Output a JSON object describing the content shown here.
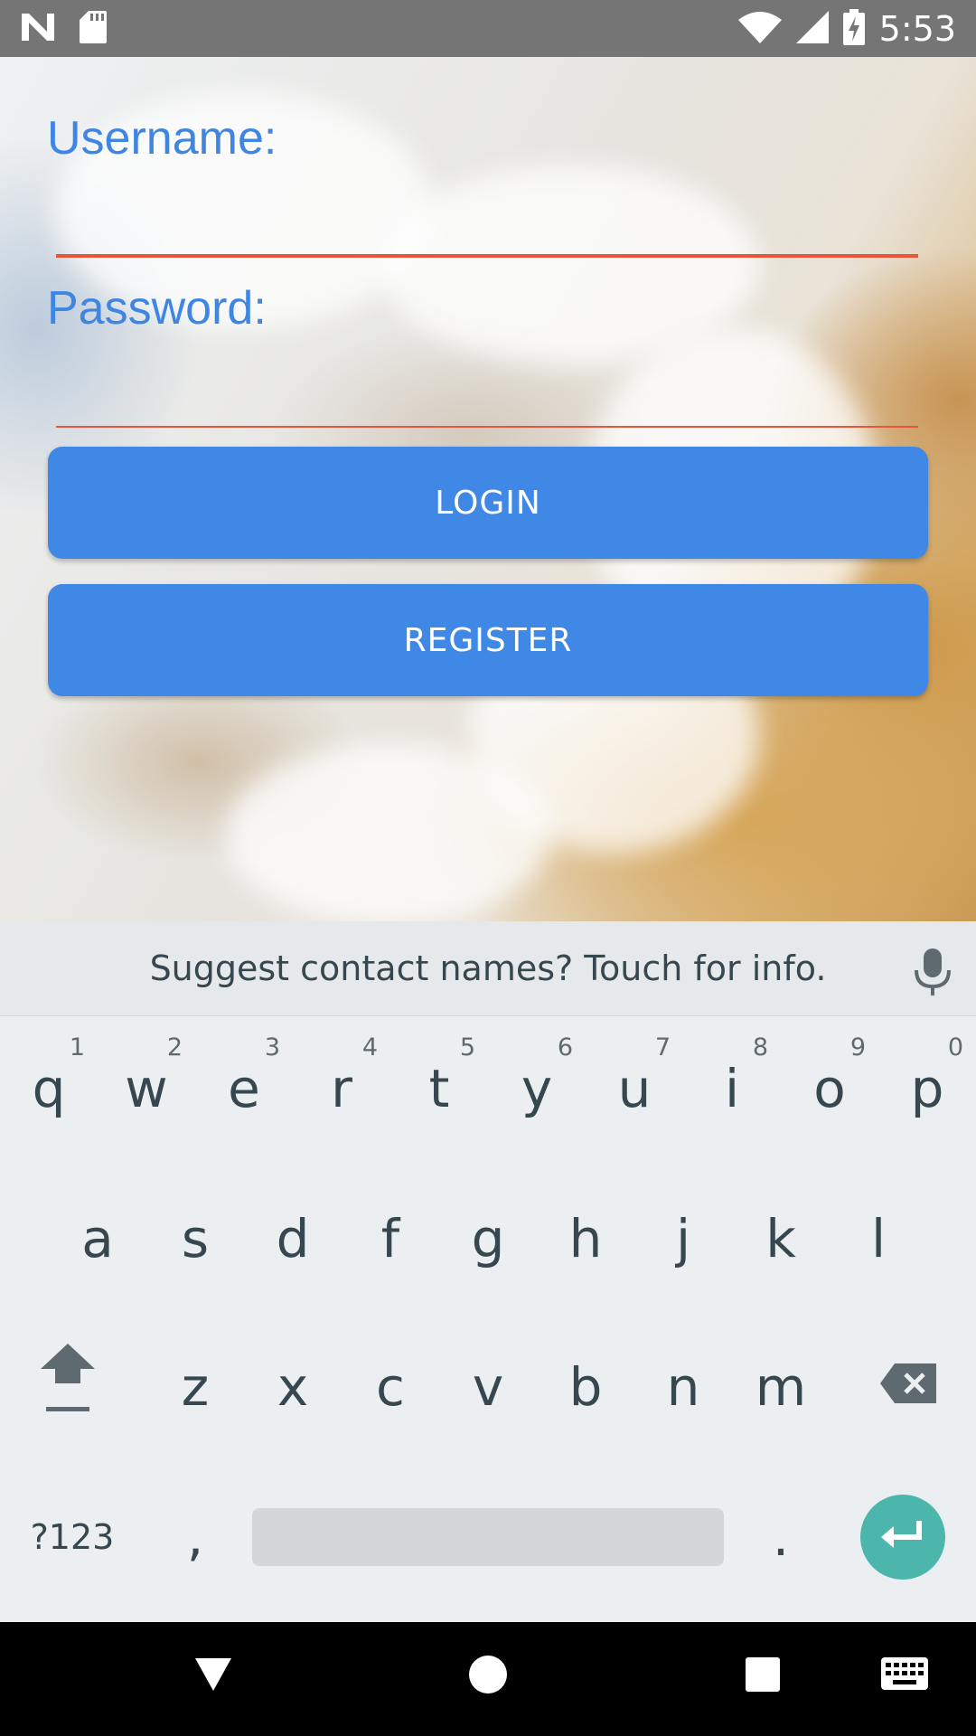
{
  "status_bar": {
    "time": "5:53",
    "left_icons": [
      "n-logo-icon",
      "sd-card-icon"
    ],
    "right_icons": [
      "wifi-icon",
      "signal-icon",
      "battery-charging-icon"
    ]
  },
  "login_form": {
    "username_label": "Username:",
    "username_value": "",
    "password_label": "Password:",
    "password_value": "",
    "login_button": "LOGIN",
    "register_button": "REGISTER",
    "accent_color": "#3f88e5",
    "underline_color": "#e8553a"
  },
  "keyboard": {
    "suggestion": "Suggest contact names? Touch for info.",
    "row1": [
      {
        "key": "q",
        "hint": "1"
      },
      {
        "key": "w",
        "hint": "2"
      },
      {
        "key": "e",
        "hint": "3"
      },
      {
        "key": "r",
        "hint": "4"
      },
      {
        "key": "t",
        "hint": "5"
      },
      {
        "key": "y",
        "hint": "6"
      },
      {
        "key": "u",
        "hint": "7"
      },
      {
        "key": "i",
        "hint": "8"
      },
      {
        "key": "o",
        "hint": "9"
      },
      {
        "key": "p",
        "hint": "0"
      }
    ],
    "row2": [
      "a",
      "s",
      "d",
      "f",
      "g",
      "h",
      "j",
      "k",
      "l"
    ],
    "row3": [
      "z",
      "x",
      "c",
      "v",
      "b",
      "n",
      "m"
    ],
    "symbols_key": "?123",
    "comma_key": ",",
    "period_key": ".",
    "enter_color": "#4db6ac"
  },
  "nav_bar": {
    "icons": [
      "back-icon",
      "home-icon",
      "recents-icon",
      "keyboard-switch-icon"
    ]
  }
}
